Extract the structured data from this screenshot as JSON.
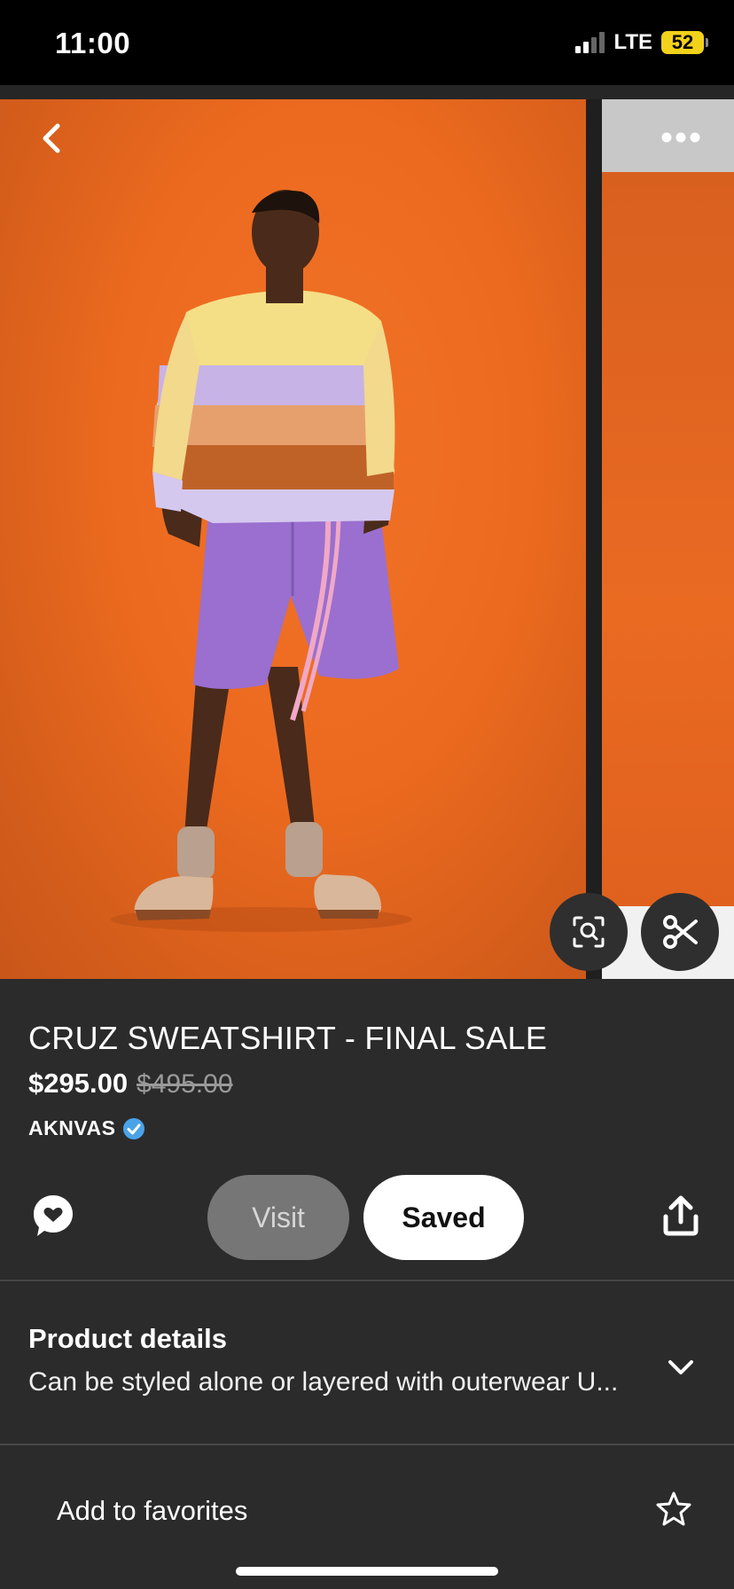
{
  "status_bar": {
    "time": "11:00",
    "network": "LTE",
    "battery": "52"
  },
  "product": {
    "title": "CRUZ SWEATSHIRT - FINAL SALE",
    "price": "$295.00",
    "original_price": "$495.00",
    "brand": "AKNVAS"
  },
  "actions": {
    "visit_label": "Visit",
    "saved_label": "Saved"
  },
  "details": {
    "title": "Product details",
    "text": "Can be styled alone or layered with outerwear U..."
  },
  "favorites": {
    "label": "Add to favorites"
  },
  "colors": {
    "background": "#2b2b2b",
    "photo_backdrop": "#ec6a1f",
    "verified_badge": "#4aa3e8",
    "battery": "#f2d21a",
    "visit_button": "#767676",
    "saved_button": "#ffffff"
  },
  "icons": [
    "back-arrow-icon",
    "more-options-icon",
    "visual-search-icon",
    "scissors-icon",
    "comment-bubble-icon",
    "share-icon",
    "chevron-down-icon",
    "star-outline-icon",
    "verified-check-icon"
  ]
}
